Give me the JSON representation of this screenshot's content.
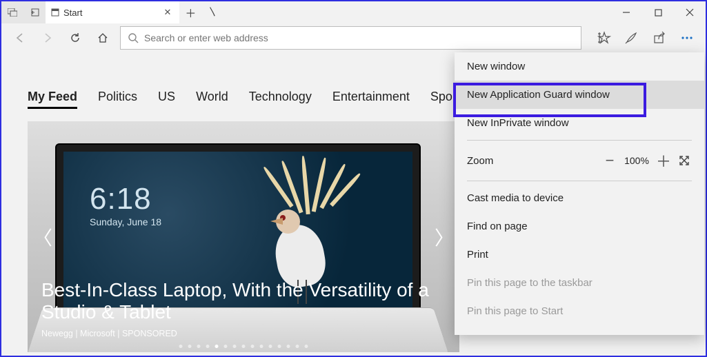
{
  "window": {
    "tab_title": "Start",
    "address_placeholder": "Search or enter web address"
  },
  "feed": {
    "tabs": [
      "My Feed",
      "Politics",
      "US",
      "World",
      "Technology",
      "Entertainment",
      "Sports"
    ],
    "active_index": 0
  },
  "hero": {
    "clock_time": "6:18",
    "clock_date": "Sunday, June 18",
    "title": "Best-In-Class Laptop, With the Versatility of a Studio & Tablet",
    "attribution": "Newegg | Microsoft | SPONSORED",
    "dot_count": 15,
    "active_dot": 4
  },
  "menu": {
    "new_window": "New window",
    "new_ag_window": "New Application Guard window",
    "new_inprivate": "New InPrivate window",
    "zoom_label": "Zoom",
    "zoom_value": "100%",
    "cast": "Cast media to device",
    "find": "Find on page",
    "print": "Print",
    "pin_taskbar": "Pin this page to the taskbar",
    "pin_start": "Pin this page to Start"
  }
}
